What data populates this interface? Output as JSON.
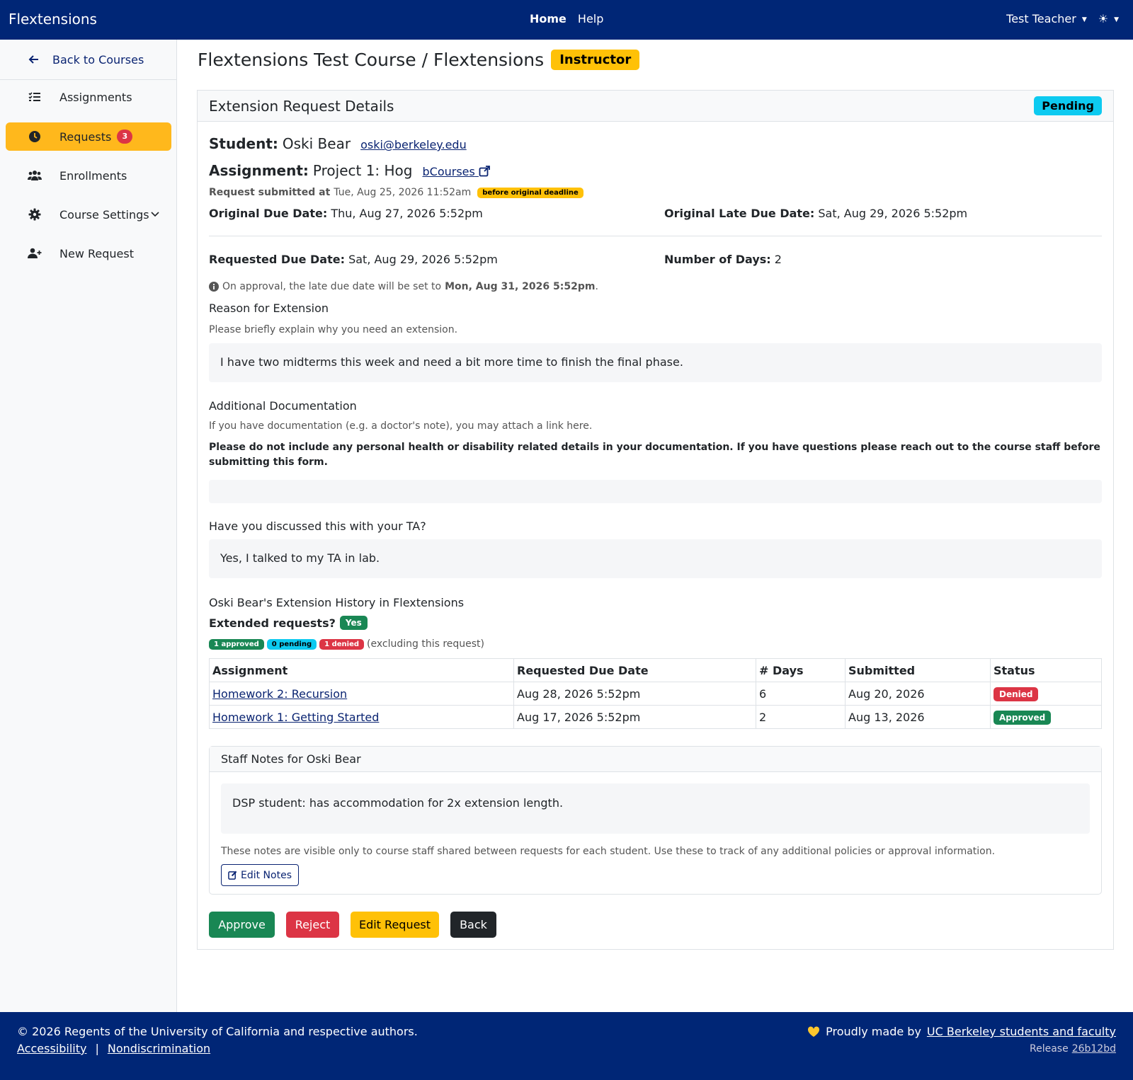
{
  "navbar": {
    "brand": "Flextensions",
    "home": "Home",
    "help": "Help",
    "user": "Test Teacher",
    "theme_icon": "☀"
  },
  "sidebar": {
    "back": "Back to Courses",
    "items": [
      {
        "label": "Assignments",
        "icon": "list-check-icon"
      },
      {
        "label": "Requests",
        "icon": "clock-icon",
        "count": "3"
      },
      {
        "label": "Enrollments",
        "icon": "users-icon"
      },
      {
        "label": "Course Settings",
        "icon": "gear-icon"
      },
      {
        "label": "New Request",
        "icon": "user-plus-icon"
      }
    ]
  },
  "page": {
    "title": "Flextensions Test Course / Flextensions",
    "role": "Instructor"
  },
  "request": {
    "header": "Extension Request Details",
    "status": "Pending",
    "student_label": "Student:",
    "student_name": "Oski Bear",
    "student_email": "oski@berkeley.edu",
    "assignment_label": "Assignment:",
    "assignment_name": "Project 1: Hog",
    "assignment_link": "bCourses",
    "submitted_label": "Request submitted at",
    "submitted_at": "Tue, Aug 25, 2026 11:52am",
    "submitted_badge": "before original deadline",
    "orig_due_label": "Original Due Date:",
    "orig_due": "Thu, Aug 27, 2026 5:52pm",
    "orig_late_label": "Original Late Due Date:",
    "orig_late": "Sat, Aug 29, 2026 5:52pm",
    "req_due_label": "Requested Due Date:",
    "req_due": "Sat, Aug 29, 2026 5:52pm",
    "days_label": "Number of Days:",
    "days": "2",
    "approval_note_prefix": "On approval, the late due date will be set to",
    "approval_note_date": "Mon, Aug 31, 2026 5:52pm",
    "reason_title": "Reason for Extension",
    "reason_help": "Please briefly explain why you need an extension.",
    "reason_text": "I have two midterms this week and need a bit more time to finish the final phase.",
    "doc_title": "Additional Documentation",
    "doc_help": "If you have documentation (e.g. a doctor's note), you may attach a link here.",
    "doc_warning": "Please do not include any personal health or disability related details in your documentation. If you have questions please reach out to the course staff before submitting this form.",
    "ta_title": "Have you discussed this with your TA?",
    "ta_text": "Yes, I talked to my TA in lab."
  },
  "history": {
    "title": "Oski Bear's Extension History in Flextensions",
    "extended_label": "Extended requests?",
    "extended_value": "Yes",
    "approved": "1 approved",
    "pending": "0 pending",
    "denied": "1 denied",
    "excluding": "(excluding this request)",
    "columns": [
      "Assignment",
      "Requested Due Date",
      "# Days",
      "Submitted",
      "Status"
    ],
    "rows": [
      {
        "assignment": "Homework 2: Recursion",
        "due": "Aug 28, 2026 5:52pm",
        "days": "6",
        "submitted": "Aug 20, 2026",
        "status": "Denied"
      },
      {
        "assignment": "Homework 1: Getting Started",
        "due": "Aug 17, 2026 5:52pm",
        "days": "2",
        "submitted": "Aug 13, 2026",
        "status": "Approved"
      }
    ]
  },
  "notes": {
    "title": "Staff Notes for Oski Bear",
    "text": "DSP student: has accommodation for 2x extension length.",
    "help": "These notes are visible only to course staff shared between requests for each student. Use these to track of any additional policies or approval information.",
    "edit": "Edit Notes"
  },
  "actions": {
    "approve": "Approve",
    "reject": "Reject",
    "edit": "Edit Request",
    "back": "Back"
  },
  "footer": {
    "copyright": "© 2026 Regents of the University of California and respective authors.",
    "accessibility": "Accessibility",
    "separator": "|",
    "nondiscrimination": "Nondiscrimination",
    "made_by": "Proudly made by",
    "made_by_link": "UC Berkeley students and faculty",
    "release_label": "Release",
    "release": "26b12bd"
  },
  "colors": {
    "navy": "#002676",
    "gold": "#ffb81c",
    "success": "#198754",
    "danger": "#dc3545",
    "info": "#0dcaf0"
  }
}
